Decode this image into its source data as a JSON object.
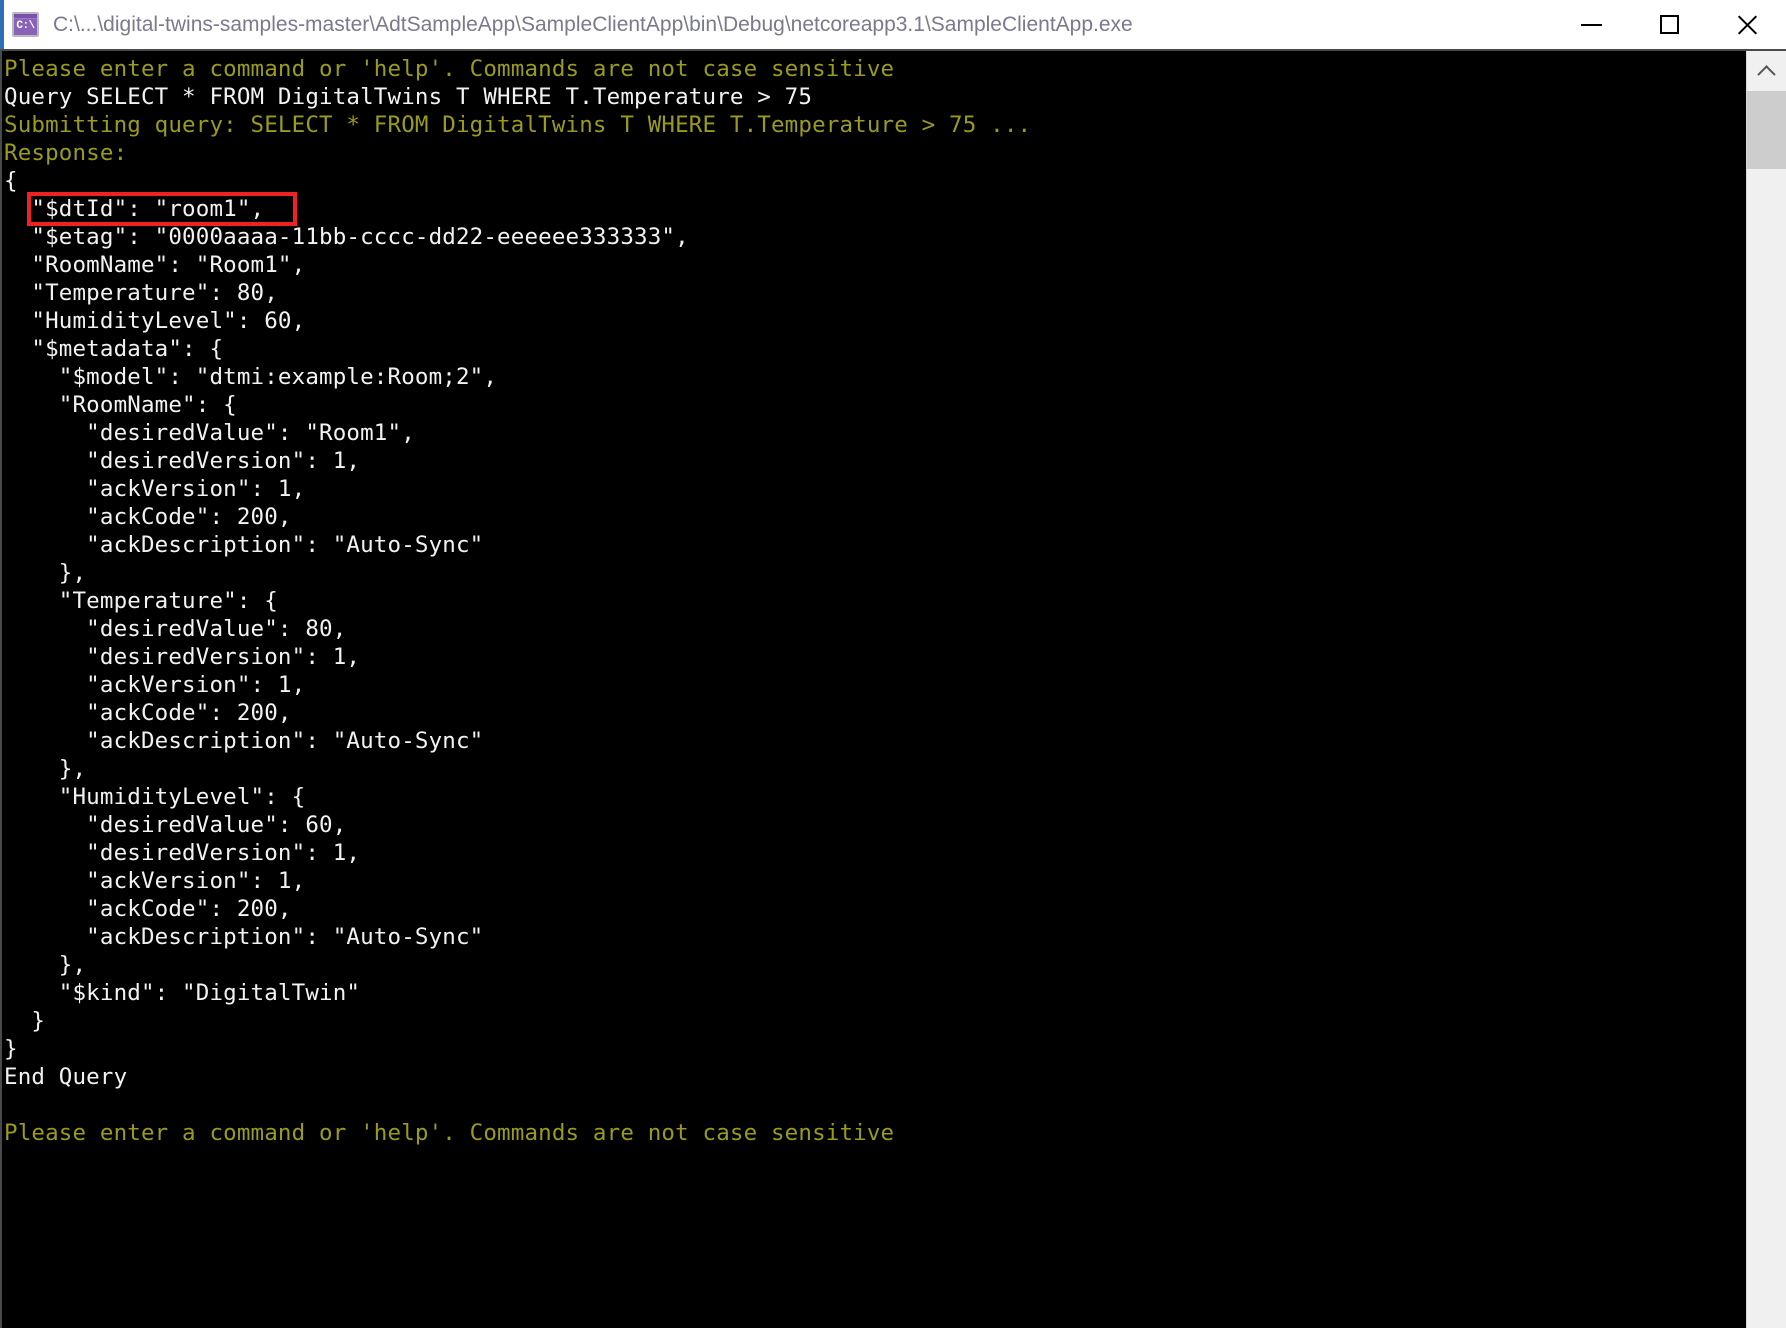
{
  "window": {
    "title": "C:\\...\\digital-twins-samples-master\\AdtSampleApp\\SampleClientApp\\bin\\Debug\\netcoreapp3.1\\SampleClientApp.exe",
    "icon_label": "C:\\",
    "icon_name": "command-prompt-icon",
    "controls": {
      "minimize": "—",
      "maximize": "☐",
      "close": "✕"
    }
  },
  "annotation": {
    "color": "#ee2222",
    "target_line_index": 5,
    "label": "highlight-dtId"
  },
  "colors": {
    "console_background": "#000000",
    "prompt_text": "#9a9a1d",
    "output_text": "#f2f2f2",
    "titlebar_background": "#ffffff",
    "titlebar_text": "#7a7a8c",
    "titlebar_accent": "#2e6fba",
    "scrollbar_track": "#f0f0f0",
    "scrollbar_thumb": "#cdcdcd"
  },
  "scrollbar": {
    "up_arrow": "chevron-up-icon",
    "down_arrow": "chevron-down-icon",
    "thumb_position_percent": 0,
    "thumb_size_percent": 6
  },
  "console": {
    "lines": [
      {
        "text": "Please enter a command or 'help'. Commands are not case sensitive",
        "color": "yellow"
      },
      {
        "text": "Query SELECT * FROM DigitalTwins T WHERE T.Temperature > 75",
        "color": "white"
      },
      {
        "text": "Submitting query: SELECT * FROM DigitalTwins T WHERE T.Temperature > 75 ...",
        "color": "yellow"
      },
      {
        "text": "Response:",
        "color": "yellow"
      },
      {
        "text": "{",
        "color": "white"
      },
      {
        "text": "  \"$dtId\": \"room1\",",
        "color": "white"
      },
      {
        "text": "  \"$etag\": \"0000aaaa-11bb-cccc-dd22-eeeeee333333\",",
        "color": "white"
      },
      {
        "text": "  \"RoomName\": \"Room1\",",
        "color": "white"
      },
      {
        "text": "  \"Temperature\": 80,",
        "color": "white"
      },
      {
        "text": "  \"HumidityLevel\": 60,",
        "color": "white"
      },
      {
        "text": "  \"$metadata\": {",
        "color": "white"
      },
      {
        "text": "    \"$model\": \"dtmi:example:Room;2\",",
        "color": "white"
      },
      {
        "text": "    \"RoomName\": {",
        "color": "white"
      },
      {
        "text": "      \"desiredValue\": \"Room1\",",
        "color": "white"
      },
      {
        "text": "      \"desiredVersion\": 1,",
        "color": "white"
      },
      {
        "text": "      \"ackVersion\": 1,",
        "color": "white"
      },
      {
        "text": "      \"ackCode\": 200,",
        "color": "white"
      },
      {
        "text": "      \"ackDescription\": \"Auto-Sync\"",
        "color": "white"
      },
      {
        "text": "    },",
        "color": "white"
      },
      {
        "text": "    \"Temperature\": {",
        "color": "white"
      },
      {
        "text": "      \"desiredValue\": 80,",
        "color": "white"
      },
      {
        "text": "      \"desiredVersion\": 1,",
        "color": "white"
      },
      {
        "text": "      \"ackVersion\": 1,",
        "color": "white"
      },
      {
        "text": "      \"ackCode\": 200,",
        "color": "white"
      },
      {
        "text": "      \"ackDescription\": \"Auto-Sync\"",
        "color": "white"
      },
      {
        "text": "    },",
        "color": "white"
      },
      {
        "text": "    \"HumidityLevel\": {",
        "color": "white"
      },
      {
        "text": "      \"desiredValue\": 60,",
        "color": "white"
      },
      {
        "text": "      \"desiredVersion\": 1,",
        "color": "white"
      },
      {
        "text": "      \"ackVersion\": 1,",
        "color": "white"
      },
      {
        "text": "      \"ackCode\": 200,",
        "color": "white"
      },
      {
        "text": "      \"ackDescription\": \"Auto-Sync\"",
        "color": "white"
      },
      {
        "text": "    },",
        "color": "white"
      },
      {
        "text": "    \"$kind\": \"DigitalTwin\"",
        "color": "white"
      },
      {
        "text": "  }",
        "color": "white"
      },
      {
        "text": "}",
        "color": "white"
      },
      {
        "text": "End Query",
        "color": "white"
      },
      {
        "text": "",
        "color": "white"
      },
      {
        "text": "Please enter a command or 'help'. Commands are not case sensitive",
        "color": "yellow"
      }
    ]
  }
}
